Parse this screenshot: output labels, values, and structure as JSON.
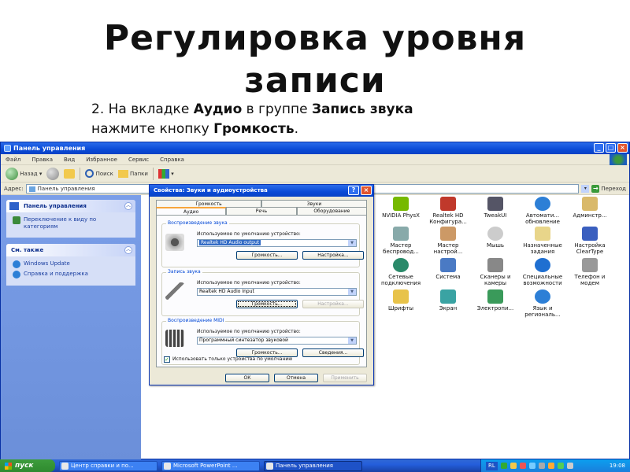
{
  "slide": {
    "title_line1": "Регулировка уровня",
    "title_line2": "записи",
    "instr_line1_a": "2. На вкладке ",
    "instr_line1_b": "Аудио",
    "instr_line1_c": " в группе ",
    "instr_line1_d": "Запись звука",
    "instr_line2_a": "нажмите кнопку ",
    "instr_line2_b": "Громкость",
    "instr_line2_c": "."
  },
  "window": {
    "title": "Панель управления",
    "menu": [
      "Файл",
      "Правка",
      "Вид",
      "Избранное",
      "Сервис",
      "Справка"
    ],
    "toolbar": {
      "back": "Назад",
      "search": "Поиск",
      "folders": "Папки"
    },
    "address_label": "Адрес:",
    "address_value": "Панель управления",
    "go_label": "Переход"
  },
  "sidebar": {
    "panel1_title": "Панель управления",
    "panel1_items": [
      "Переключение к виду по категориям"
    ],
    "panel2_title": "См. также",
    "panel2_items": [
      "Windows Update",
      "Справка и поддержка"
    ]
  },
  "icons": {
    "nvidia": "NVIDIA PhysX",
    "realtek": "Realtek HD Конфигура...",
    "tweakui": "TweakUI",
    "autoupdate": "Автомати... обновление",
    "admin": "Админстр...",
    "wireless": "Мастер беспровод...",
    "netsetup": "Мастер настрой...",
    "mouse": "Мышь",
    "scheduled": "Назначенные задания",
    "cleartype": "Настройка ClearType",
    "network": "Сетевые подключения",
    "system": "Система",
    "scanners": "Сканеры и камеры",
    "accessibility": "Специальные возможности",
    "phone": "Телефон и модем",
    "fonts": "Шрифты",
    "screen": "Экран",
    "power": "Электропи...",
    "regional": "Язык и региональ..."
  },
  "dialog": {
    "title": "Свойства: Звуки и аудиоустройства",
    "tabs_top": [
      "Громкость",
      "Звуки"
    ],
    "tabs_bottom": [
      "Аудио",
      "Речь",
      "Оборудование"
    ],
    "playback": {
      "label": "Воспроизведение звука",
      "default_text": "Используемое по умолчанию устройство:",
      "device": "Realtek HD Audio output",
      "volume_btn": "Громкость...",
      "settings_btn": "Настройка..."
    },
    "recording": {
      "label": "Запись звука",
      "default_text": "Используемое по умолчанию устройство:",
      "device": "Realtek HD Audio Input",
      "volume_btn": "Громкость...",
      "settings_btn": "Настройка..."
    },
    "midi": {
      "label": "Воспроизведение MIDI",
      "default_text": "Используемое по умолчанию устройство:",
      "device": "Программный синтезатор звуковой",
      "volume_btn": "Громкость...",
      "about_btn": "Сведения..."
    },
    "checkbox_label": "Использовать только устройства по умолчанию",
    "ok": "ОК",
    "cancel": "Отмена",
    "apply": "Применить"
  },
  "taskbar": {
    "start": "пуск",
    "tasks": [
      "Центр справки и по...",
      "Microsoft PowerPoint ...",
      "Панель управления"
    ],
    "lang": "RL",
    "clock": "19:08"
  }
}
